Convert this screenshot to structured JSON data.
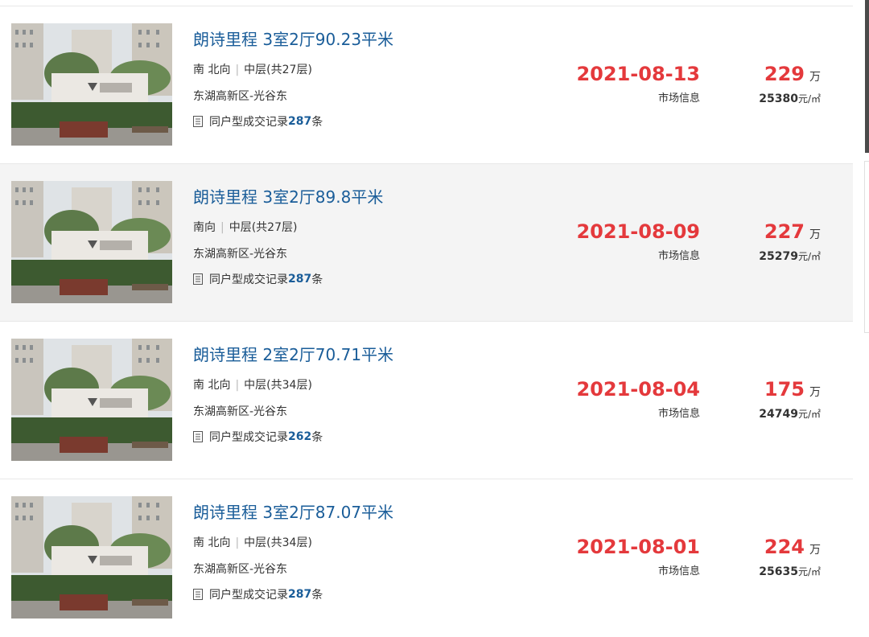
{
  "listings": [
    {
      "title": "朗诗里程 3室2厅90.23平米",
      "orientation": "南 北向",
      "floor": "中层(共27层)",
      "district": "东湖高新区-光谷东",
      "deal_prefix": "同户型成交记录",
      "deal_count": "287",
      "deal_suffix": "条",
      "date": "2021-08-13",
      "source": "市场信息",
      "price": "229",
      "price_unit": "万",
      "unit_price": "25380",
      "unit_price_unit": "元/㎡"
    },
    {
      "title": "朗诗里程 3室2厅89.8平米",
      "orientation": "南向",
      "floor": "中层(共27层)",
      "district": "东湖高新区-光谷东",
      "deal_prefix": "同户型成交记录",
      "deal_count": "287",
      "deal_suffix": "条",
      "date": "2021-08-09",
      "source": "市场信息",
      "price": "227",
      "price_unit": "万",
      "unit_price": "25279",
      "unit_price_unit": "元/㎡"
    },
    {
      "title": "朗诗里程 2室2厅70.71平米",
      "orientation": "南 北向",
      "floor": "中层(共34层)",
      "district": "东湖高新区-光谷东",
      "deal_prefix": "同户型成交记录",
      "deal_count": "262",
      "deal_suffix": "条",
      "date": "2021-08-04",
      "source": "市场信息",
      "price": "175",
      "price_unit": "万",
      "unit_price": "24749",
      "unit_price_unit": "元/㎡"
    },
    {
      "title": "朗诗里程 3室2厅87.07平米",
      "orientation": "南 北向",
      "floor": "中层(共34层)",
      "district": "东湖高新区-光谷东",
      "deal_prefix": "同户型成交记录",
      "deal_count": "287",
      "deal_suffix": "条",
      "date": "2021-08-01",
      "source": "市场信息",
      "price": "224",
      "price_unit": "万",
      "unit_price": "25635",
      "unit_price_unit": "元/㎡"
    }
  ],
  "meta_separator": "|",
  "colors": {
    "title": "#1a5d99",
    "price": "#e4393c",
    "highlight_row": "#f4f4f4"
  },
  "icons": {
    "deal_record": "document-icon"
  }
}
